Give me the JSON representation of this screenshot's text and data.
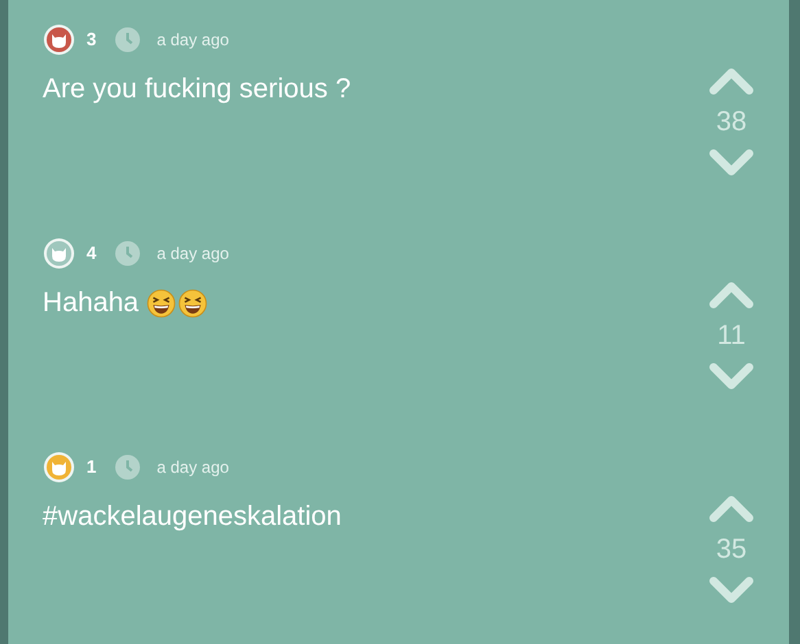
{
  "posts": [
    {
      "color": "#c8574a",
      "karma": "3",
      "time": "a day ago",
      "text": "Are you fucking serious ?",
      "votes": "38"
    },
    {
      "color": "#9fc7bd",
      "karma": "4",
      "time": "a day ago",
      "text": "Hahaha",
      "emojis": [
        {
          "kind": "laughing"
        },
        {
          "kind": "laughing"
        }
      ],
      "votes": "11"
    },
    {
      "color": "#f0b335",
      "karma": "1",
      "time": "a day ago",
      "text": "#wackelaugeneskalation",
      "votes": "35"
    }
  ]
}
